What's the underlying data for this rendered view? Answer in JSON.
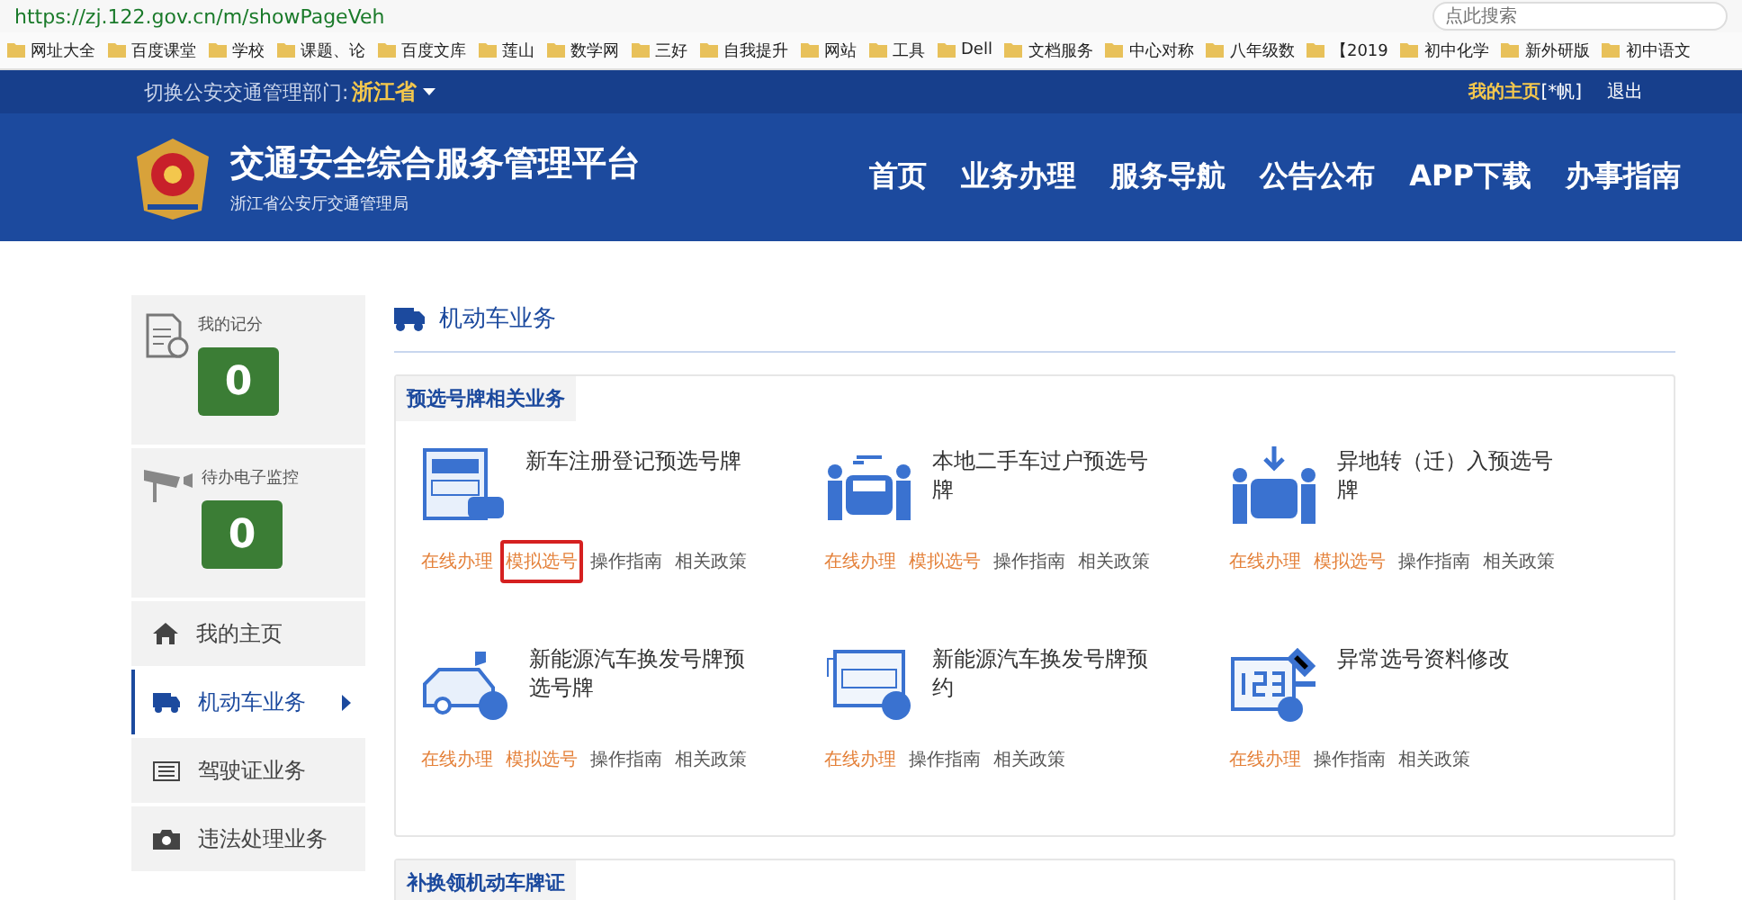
{
  "browser": {
    "url": "https://zj.122.gov.cn/m/showPageVeh",
    "search_placeholder": "点此搜索",
    "bookmarks": [
      "网址大全",
      "百度课堂",
      "学校",
      "课题、论",
      "百度文库",
      "莲山",
      "数学网",
      "三好",
      "自我提升",
      "网站",
      "工具",
      "Dell",
      "文档服务",
      "中心对称",
      "八年级数",
      "【2019",
      "初中化学",
      "新外研版",
      "初中语文"
    ]
  },
  "top_strip": {
    "label": "切换公安交通管理部门:",
    "region": "浙江省",
    "home_link": "我的主页",
    "user": "[*帆]",
    "logout": "退出"
  },
  "header": {
    "title": "交通安全综合服务管理平台",
    "subtitle": "浙江省公安厅交通管理局",
    "nav": [
      "首页",
      "业务办理",
      "服务导航",
      "公告公布",
      "APP下载",
      "办事指南"
    ]
  },
  "sidebar": {
    "scores": [
      {
        "label": "我的记分",
        "value": "0"
      },
      {
        "label": "待办电子监控",
        "value": "0"
      }
    ],
    "items": [
      {
        "label": "我的主页",
        "selected": false
      },
      {
        "label": "机动车业务",
        "selected": true
      },
      {
        "label": "驾驶证业务",
        "selected": false
      },
      {
        "label": "违法处理业务",
        "selected": false
      }
    ]
  },
  "content": {
    "title": "机动车业务",
    "cards": [
      {
        "tab": "预选号牌相关业务",
        "services": [
          {
            "title": "新车注册登记预选号牌",
            "links": [
              {
                "label": "在线办理",
                "kind": "action",
                "highlighted": false
              },
              {
                "label": "模拟选号",
                "kind": "action",
                "highlighted": true
              },
              {
                "label": "操作指南",
                "kind": "info",
                "highlighted": false
              },
              {
                "label": "相关政策",
                "kind": "info",
                "highlighted": false
              }
            ]
          },
          {
            "title": "本地二手车过户预选号牌",
            "links": [
              {
                "label": "在线办理",
                "kind": "action",
                "highlighted": false
              },
              {
                "label": "模拟选号",
                "kind": "action",
                "highlighted": false
              },
              {
                "label": "操作指南",
                "kind": "info",
                "highlighted": false
              },
              {
                "label": "相关政策",
                "kind": "info",
                "highlighted": false
              }
            ]
          },
          {
            "title": "异地转（迁）入预选号牌",
            "links": [
              {
                "label": "在线办理",
                "kind": "action",
                "highlighted": false
              },
              {
                "label": "模拟选号",
                "kind": "action",
                "highlighted": false
              },
              {
                "label": "操作指南",
                "kind": "info",
                "highlighted": false
              },
              {
                "label": "相关政策",
                "kind": "info",
                "highlighted": false
              }
            ]
          },
          {
            "title": "新能源汽车换发号牌预选号牌",
            "links": [
              {
                "label": "在线办理",
                "kind": "action",
                "highlighted": false
              },
              {
                "label": "模拟选号",
                "kind": "action",
                "highlighted": false
              },
              {
                "label": "操作指南",
                "kind": "info",
                "highlighted": false
              },
              {
                "label": "相关政策",
                "kind": "info",
                "highlighted": false
              }
            ]
          },
          {
            "title": "新能源汽车换发号牌预约",
            "links": [
              {
                "label": "在线办理",
                "kind": "action",
                "highlighted": false
              },
              {
                "label": "操作指南",
                "kind": "info",
                "highlighted": false
              },
              {
                "label": "相关政策",
                "kind": "info",
                "highlighted": false
              }
            ]
          },
          {
            "title": "异常选号资料修改",
            "links": [
              {
                "label": "在线办理",
                "kind": "action",
                "highlighted": false
              },
              {
                "label": "操作指南",
                "kind": "info",
                "highlighted": false
              },
              {
                "label": "相关政策",
                "kind": "info",
                "highlighted": false
              }
            ]
          }
        ]
      },
      {
        "tab": "补换领机动车牌证"
      }
    ]
  }
}
